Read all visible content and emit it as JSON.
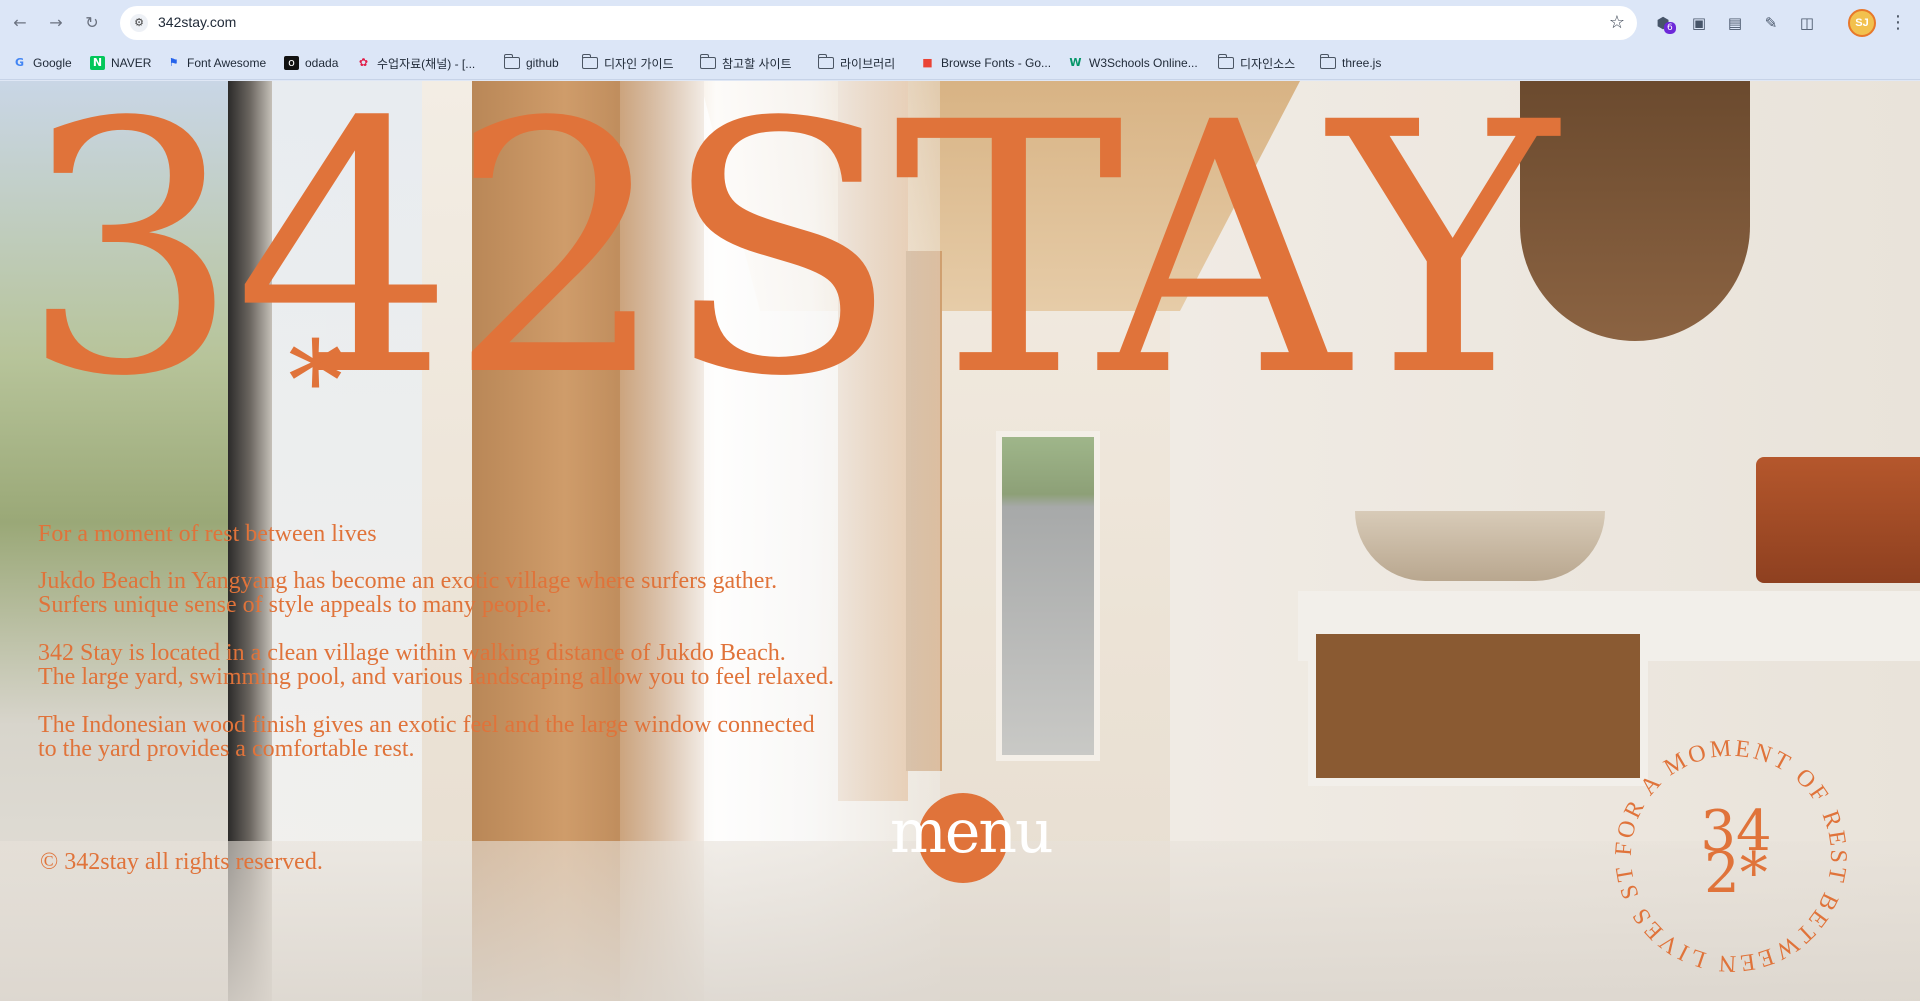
{
  "browser": {
    "url": "342stay.com",
    "profile_initials": "SJ",
    "extension_badge": "6",
    "bookmarks": [
      {
        "label": "Google",
        "icon": "google-icon"
      },
      {
        "label": "NAVER",
        "icon": "naver-icon"
      },
      {
        "label": "Font Awesome",
        "icon": "flag-icon"
      },
      {
        "label": "odada",
        "icon": "odada-icon"
      },
      {
        "label": "수업자료(채널) - [...",
        "icon": "pinwheel-icon"
      },
      {
        "label": "github",
        "icon": "folder-icon"
      },
      {
        "label": "디자인 가이드",
        "icon": "folder-icon"
      },
      {
        "label": "참고할 사이트",
        "icon": "folder-icon"
      },
      {
        "label": "라이브러리",
        "icon": "folder-icon"
      },
      {
        "label": "Browse Fonts - Go...",
        "icon": "google-fonts-icon"
      },
      {
        "label": "W3Schools Online...",
        "icon": "w3schools-icon"
      },
      {
        "label": "디자인소스",
        "icon": "folder-icon"
      },
      {
        "label": "three.js",
        "icon": "folder-icon"
      }
    ]
  },
  "hero": {
    "title": "342STAY",
    "asterisk": "*",
    "tagline": "For a moment of rest between lives",
    "paragraphs": [
      [
        "Jukdo Beach in Yangyang has become an exotic village where surfers gather.",
        "Surfers unique sense of style appeals to many people."
      ],
      [
        "342 Stay is located in a clean village within walking distance of Jukdo Beach.",
        "The large yard, swimming pool, and various landscaping allow you to feel relaxed."
      ],
      [
        "The Indonesian wood finish gives an exotic feel and the large window connected",
        "to the yard provides a comfortable rest."
      ]
    ],
    "copyright": "© 342stay all rights reserved.",
    "menu_label": "menu"
  },
  "badge": {
    "ring_text": "FOR A MOMENT OF REST BETWEEN LIVES STAY. ",
    "center_top": "34",
    "center_bottom": "2*"
  },
  "colors": {
    "accent": "#e0733a",
    "chrome": "#dce6f7"
  }
}
